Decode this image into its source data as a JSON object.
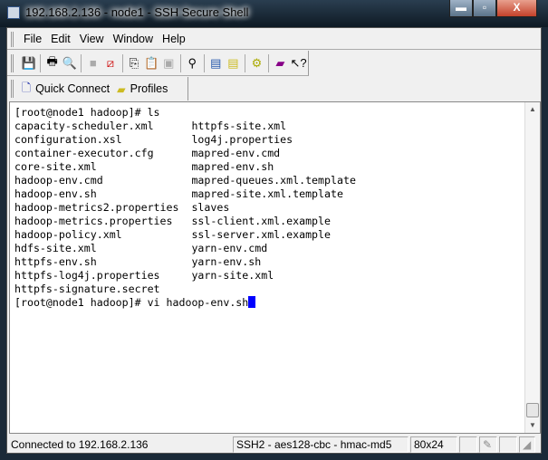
{
  "window": {
    "title": "192.168.2.136 - node1 - SSH Secure Shell",
    "minimize": "▬",
    "maximize": "▫",
    "close": "X"
  },
  "menu": [
    "File",
    "Edit",
    "View",
    "Window",
    "Help"
  ],
  "toolbar": {
    "icons": [
      "save-icon",
      "print-icon",
      "print-preview-icon",
      "|",
      "disconnect-icon",
      "settings-disabled-icon",
      "|",
      "copy-icon",
      "paste-icon",
      "paste-disabled-icon",
      "|",
      "find-icon",
      "|",
      "new-terminal-icon",
      "new-file-transfer-icon",
      "|",
      "key-settings-icon",
      "|",
      "help-book-icon",
      "context-help-icon"
    ]
  },
  "quickbar": {
    "quick_connect": "Quick Connect",
    "profiles": "Profiles"
  },
  "terminal": {
    "lines": [
      "[root@node1 hadoop]# ls",
      "capacity-scheduler.xml      httpfs-site.xml",
      "configuration.xsl           log4j.properties",
      "container-executor.cfg      mapred-env.cmd",
      "core-site.xml               mapred-env.sh",
      "hadoop-env.cmd              mapred-queues.xml.template",
      "hadoop-env.sh               mapred-site.xml.template",
      "hadoop-metrics2.properties  slaves",
      "hadoop-metrics.properties   ssl-client.xml.example",
      "hadoop-policy.xml           ssl-server.xml.example",
      "hdfs-site.xml               yarn-env.cmd",
      "httpfs-env.sh               yarn-env.sh",
      "httpfs-log4j.properties     yarn-site.xml",
      "httpfs-signature.secret"
    ],
    "prompt_line": "[root@node1 hadoop]# vi hadoop-env.sh"
  },
  "status": {
    "connection": "Connected to 192.168.2.136",
    "cipher": "SSH2 - aes128-cbc - hmac-md5",
    "size": "80x24"
  }
}
